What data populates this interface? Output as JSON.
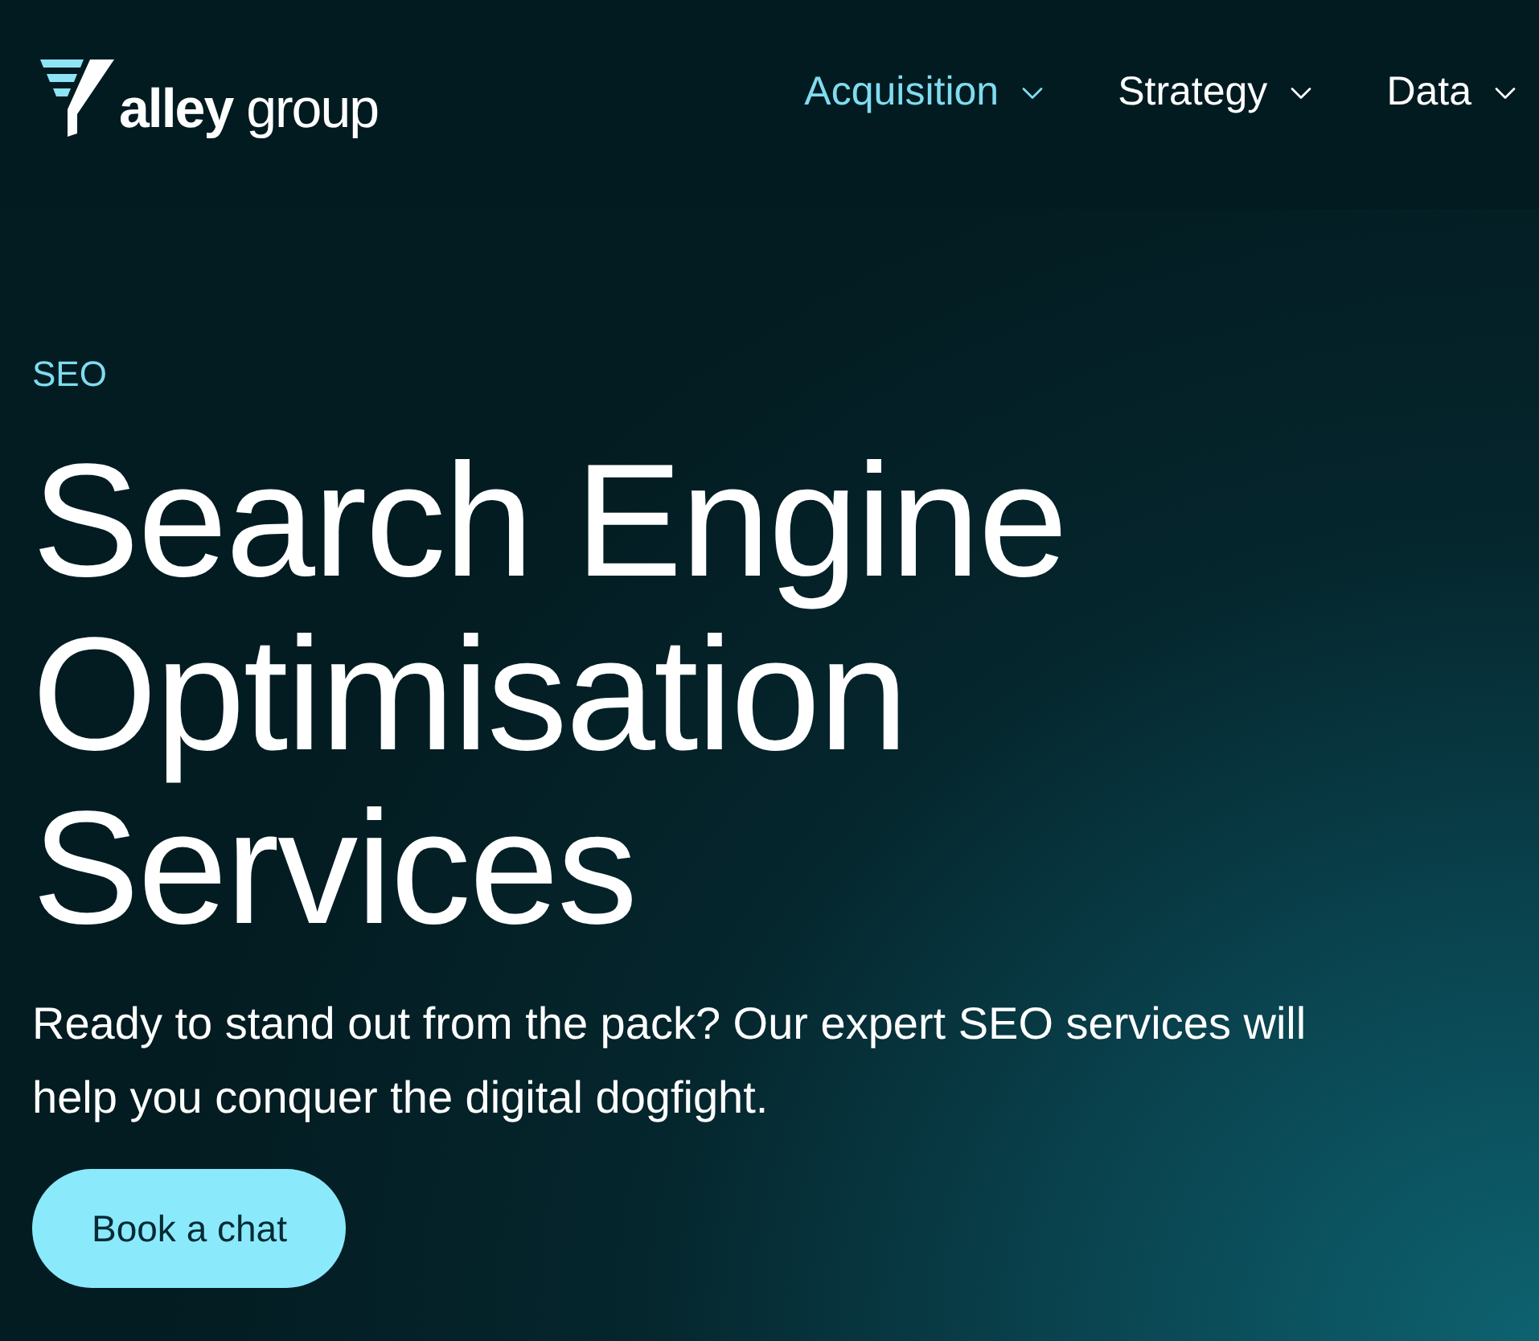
{
  "header": {
    "logo": {
      "text": "**alley** group"
    },
    "nav": [
      {
        "label": "Acquisition",
        "selected": true
      },
      {
        "label": "Strategy",
        "selected": false
      },
      {
        "label": "Data",
        "selected": false
      }
    ]
  },
  "hero": {
    "eyebrow": "SEO",
    "title": "Search Engine Optimisation Services",
    "description": "Ready to stand out from the pack? Our expert SEO services will help you conquer the digital dogfight.",
    "button": "Book a chat"
  }
}
